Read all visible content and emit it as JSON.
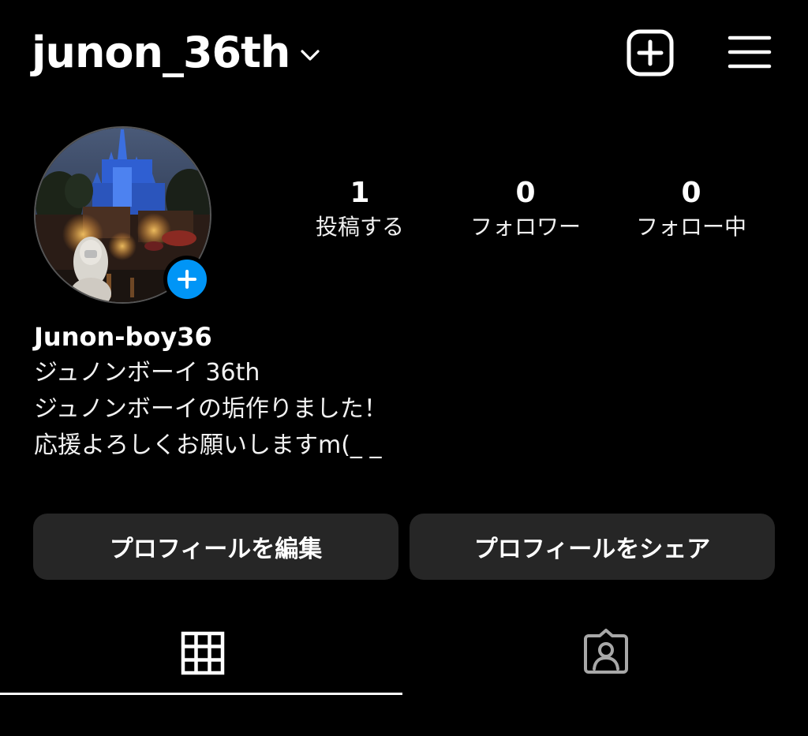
{
  "header": {
    "username": "junon_36th",
    "icons": {
      "dropdown": "chevron-down-icon",
      "new_post": "plus-square-icon",
      "menu": "hamburger-menu-icon"
    }
  },
  "profile": {
    "avatar": "profile-photo-castle-night",
    "add_story_icon": "plus-icon",
    "stats": [
      {
        "value": "1",
        "label": "投稿する"
      },
      {
        "value": "0",
        "label": "フォロワー"
      },
      {
        "value": "0",
        "label": "フォロー中"
      }
    ],
    "display_name": "Junon-boy36",
    "bio_lines": [
      "ジュノンボーイ 36th",
      "ジュノンボーイの垢作りました！",
      "応援よろしくお願いしますm(_ _"
    ]
  },
  "actions": {
    "edit_profile": "プロフィールを編集",
    "share_profile": "プロフィールをシェア"
  },
  "tabs": {
    "posts_icon": "grid-icon",
    "tagged_icon": "tagged-person-icon",
    "active": "posts"
  },
  "colors": {
    "background": "#000000",
    "button_bg": "#262626",
    "accent": "#0095f6",
    "text": "#ffffff"
  }
}
